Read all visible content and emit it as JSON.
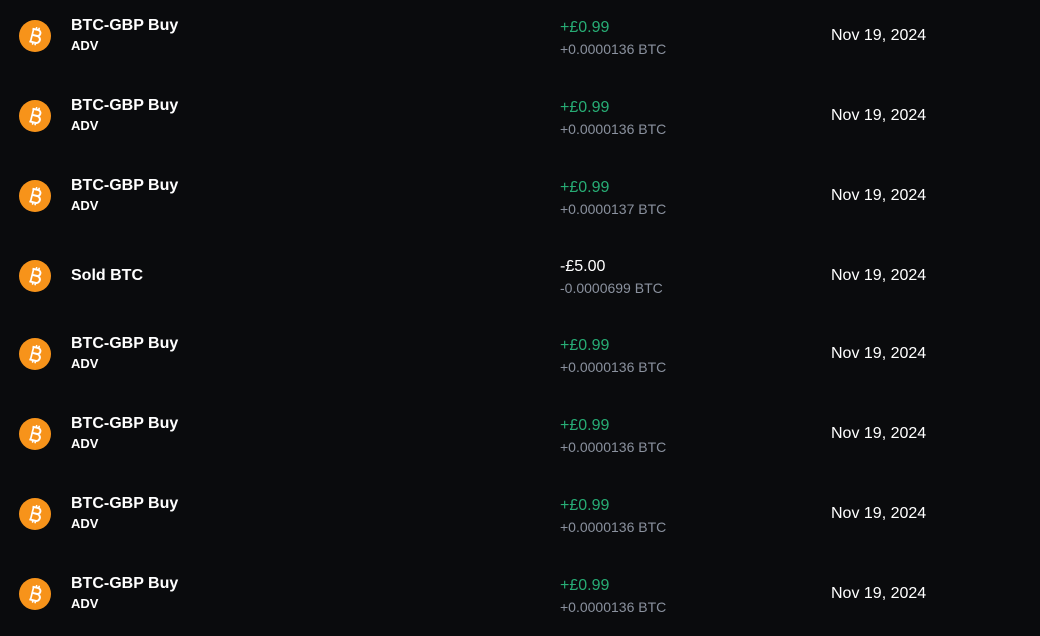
{
  "colors": {
    "background": "#0a0b0d",
    "positive": "#27ad75",
    "muted": "#8a919e",
    "btc_orange": "#f7931a"
  },
  "transactions": [
    {
      "title": "BTC-GBP Buy",
      "subtitle": "ADV",
      "amount": "+£0.99",
      "crypto": "+0.0000136 BTC",
      "date": "Nov 19, 2024",
      "icon": "bitcoin-icon"
    },
    {
      "title": "BTC-GBP Buy",
      "subtitle": "ADV",
      "amount": "+£0.99",
      "crypto": "+0.0000136 BTC",
      "date": "Nov 19, 2024",
      "icon": "bitcoin-icon"
    },
    {
      "title": "BTC-GBP Buy",
      "subtitle": "ADV",
      "amount": "+£0.99",
      "crypto": "+0.0000137 BTC",
      "date": "Nov 19, 2024",
      "icon": "bitcoin-icon"
    },
    {
      "title": "Sold BTC",
      "subtitle": "",
      "amount": "-£5.00",
      "crypto": "-0.0000699 BTC",
      "date": "Nov 19, 2024",
      "icon": "bitcoin-icon"
    },
    {
      "title": "BTC-GBP Buy",
      "subtitle": "ADV",
      "amount": "+£0.99",
      "crypto": "+0.0000136 BTC",
      "date": "Nov 19, 2024",
      "icon": "bitcoin-icon"
    },
    {
      "title": "BTC-GBP Buy",
      "subtitle": "ADV",
      "amount": "+£0.99",
      "crypto": "+0.0000136 BTC",
      "date": "Nov 19, 2024",
      "icon": "bitcoin-icon"
    },
    {
      "title": "BTC-GBP Buy",
      "subtitle": "ADV",
      "amount": "+£0.99",
      "crypto": "+0.0000136 BTC",
      "date": "Nov 19, 2024",
      "icon": "bitcoin-icon"
    },
    {
      "title": "BTC-GBP Buy",
      "subtitle": "ADV",
      "amount": "+£0.99",
      "crypto": "+0.0000136 BTC",
      "date": "Nov 19, 2024",
      "icon": "bitcoin-icon"
    }
  ]
}
